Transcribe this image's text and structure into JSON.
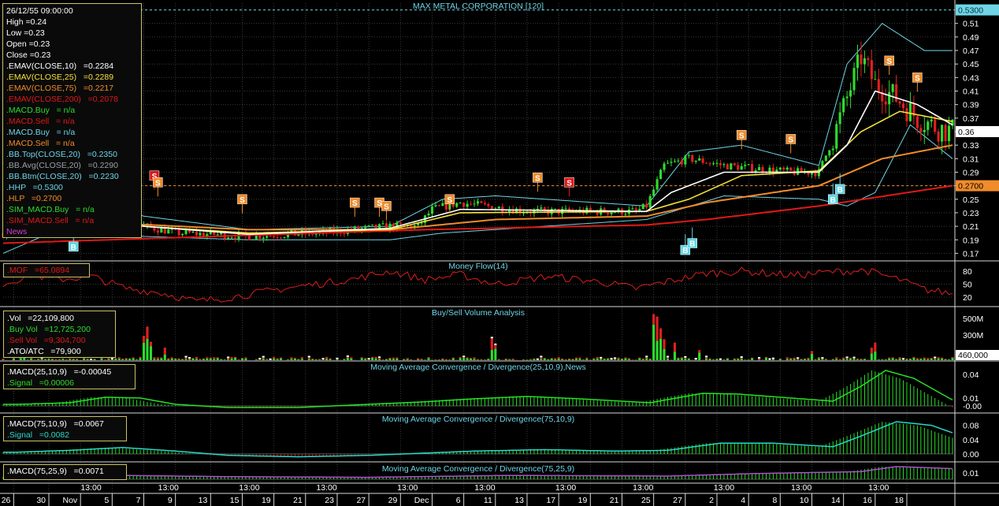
{
  "chart_title": "MAX METAL CORPORATION [120]",
  "info": {
    "date": "26/12/55 09:00:00",
    "high": "High =0.24",
    "low": "Low =0.23",
    "open": "Open =0.23",
    "close": "Close =0.23",
    "emav10": ".EMAV(CLOSE,10)   =0.2284",
    "emav25": ".EMAV(CLOSE,25)   =0.2289",
    "emav75": ".EMAV(CLOSE,75)   =0.2217",
    "emav200": ".EMAV(CLOSE,200)   =0.2078",
    "macd_buy": ".MACD.Buy   = n/a",
    "macd_sell": ".MACD.Sell   = n/a",
    "macd_buy2": ".MACD.Buy   = n/a",
    "macd_sell2": ".MACD.Sell   = n/a",
    "bb_top": ".BB.Top(CLOSE,20)   =0.2350",
    "bb_avg": ".BB.Avg(CLOSE,20)   =0.2290",
    "bb_btm": ".BB.Btm(CLOSE,20)   =0.2230",
    "hhp": ".HHP   =0.5300",
    "hlp": ".HLP   =0.2700",
    "sim_buy": ".SIM_MACD.Buy   = n/a",
    "sim_sell": ".SIM_MACD.Sell   = n/a",
    "news": "News"
  },
  "mof_label": ".MOF   =65.0894",
  "vol_info": {
    "vol": ".Vol   =22,109,800",
    "buy": ".Buy Vol   =12,725,200",
    "sell": ".Sell Vol   =9,304,700",
    "ato": ".ATO/ATC   =79,900"
  },
  "macd1_info": {
    "macd": ".MACD(25,10,9)   =-0.00045",
    "signal": ".Signal   =0.00006"
  },
  "macd2_info": {
    "macd": ".MACD(75,10,9)   =0.0067",
    "signal": ".Signal   =0.0082"
  },
  "macd3_info": {
    "macd": ".MACD(75,25,9)   =0.0071"
  },
  "panel_titles": {
    "mf": "Money Flow(14)",
    "vol": "Buy/Sell Volume Analysis",
    "macd1": "Moving Average Convergence / Divergence(25,10,9),News",
    "macd2": "Moving Average Convergence / Divergence(75,10,9)",
    "macd3": "Moving Average Convergence / Divergence(75,25,9)"
  },
  "colors": {
    "background": "#000000",
    "grid": "#3a3a3a",
    "candle_up": "#2edb2e",
    "candle_down": "#e02020",
    "ema10": "#ffffff",
    "ema25": "#f5e33a",
    "ema75": "#f08c2a",
    "ema200": "#e01818",
    "bollinger": "#6fd5e6",
    "macd_green": "#27e027",
    "macd2_line": "#28d7c8",
    "money_flow": "#d81e1e",
    "hhp_line": "#6fd5e6",
    "hlp_line": "#f08c2a"
  },
  "chart_data": [
    {
      "id": "price",
      "type": "candlestick",
      "title": "MAX METAL CORPORATION [120]",
      "ylim": [
        0.16,
        0.54
      ],
      "y_ticks": [
        0.17,
        0.19,
        0.21,
        0.23,
        0.25,
        0.27,
        0.29,
        0.31,
        0.33,
        0.35,
        0.37,
        0.39,
        0.41,
        0.43,
        0.45,
        0.47,
        0.49,
        0.51
      ],
      "y_tick_labels": [
        "0.17",
        "0.19",
        "0.21",
        "0.23",
        "0.25",
        "0.27",
        "0.29",
        "0.31",
        "0.33",
        "0.35",
        "0.37",
        "0.39",
        "0.41",
        "0.43",
        "0.45",
        "0.47",
        "0.49",
        "0.51"
      ],
      "last_close_label": "0.36",
      "hhp": 0.53,
      "hhp_label": "0.5300",
      "hlp": 0.27,
      "hlp_label": "0.2700",
      "close_keypoints": [
        [
          0,
          0.2
        ],
        [
          5,
          0.205
        ],
        [
          10,
          0.22
        ],
        [
          15,
          0.23
        ],
        [
          20,
          0.24
        ],
        [
          25,
          0.235
        ],
        [
          30,
          0.225
        ],
        [
          35,
          0.215
        ],
        [
          40,
          0.21
        ],
        [
          45,
          0.205
        ],
        [
          50,
          0.2
        ],
        [
          60,
          0.198
        ],
        [
          70,
          0.195
        ],
        [
          80,
          0.198
        ],
        [
          90,
          0.2
        ],
        [
          100,
          0.205
        ],
        [
          110,
          0.21
        ],
        [
          118,
          0.21
        ],
        [
          122,
          0.235
        ],
        [
          130,
          0.245
        ],
        [
          140,
          0.238
        ],
        [
          150,
          0.232
        ],
        [
          160,
          0.232
        ],
        [
          170,
          0.232
        ],
        [
          180,
          0.232
        ],
        [
          183,
          0.24
        ],
        [
          188,
          0.3
        ],
        [
          195,
          0.31
        ],
        [
          205,
          0.3
        ],
        [
          215,
          0.295
        ],
        [
          225,
          0.29
        ],
        [
          232,
          0.29
        ],
        [
          236,
          0.34
        ],
        [
          240,
          0.4
        ],
        [
          244,
          0.46
        ],
        [
          248,
          0.42
        ],
        [
          254,
          0.4
        ],
        [
          260,
          0.37
        ],
        [
          266,
          0.355
        ],
        [
          270,
          0.35
        ]
      ],
      "ema10": [
        [
          0,
          0.205
        ],
        [
          20,
          0.235
        ],
        [
          40,
          0.21
        ],
        [
          70,
          0.198
        ],
        [
          110,
          0.207
        ],
        [
          130,
          0.235
        ],
        [
          183,
          0.232
        ],
        [
          190,
          0.26
        ],
        [
          205,
          0.29
        ],
        [
          232,
          0.29
        ],
        [
          240,
          0.33
        ],
        [
          248,
          0.41
        ],
        [
          260,
          0.39
        ],
        [
          270,
          0.36
        ]
      ],
      "ema25": [
        [
          0,
          0.205
        ],
        [
          20,
          0.225
        ],
        [
          40,
          0.21
        ],
        [
          70,
          0.2
        ],
        [
          110,
          0.205
        ],
        [
          130,
          0.23
        ],
        [
          183,
          0.232
        ],
        [
          195,
          0.25
        ],
        [
          210,
          0.285
        ],
        [
          232,
          0.292
        ],
        [
          244,
          0.35
        ],
        [
          255,
          0.38
        ],
        [
          270,
          0.365
        ]
      ],
      "ema75": [
        [
          0,
          0.2
        ],
        [
          30,
          0.215
        ],
        [
          70,
          0.205
        ],
        [
          110,
          0.205
        ],
        [
          140,
          0.22
        ],
        [
          183,
          0.225
        ],
        [
          200,
          0.245
        ],
        [
          232,
          0.27
        ],
        [
          250,
          0.31
        ],
        [
          270,
          0.33
        ]
      ],
      "ema200": [
        [
          0,
          0.185
        ],
        [
          60,
          0.195
        ],
        [
          120,
          0.205
        ],
        [
          183,
          0.212
        ],
        [
          200,
          0.22
        ],
        [
          232,
          0.24
        ],
        [
          270,
          0.27
        ]
      ],
      "bb_top": [
        [
          0,
          0.2
        ],
        [
          10,
          0.22
        ],
        [
          20,
          0.255
        ],
        [
          40,
          0.225
        ],
        [
          70,
          0.205
        ],
        [
          110,
          0.21
        ],
        [
          125,
          0.25
        ],
        [
          140,
          0.255
        ],
        [
          183,
          0.24
        ],
        [
          195,
          0.32
        ],
        [
          210,
          0.33
        ],
        [
          232,
          0.3
        ],
        [
          240,
          0.45
        ],
        [
          250,
          0.51
        ],
        [
          262,
          0.47
        ],
        [
          270,
          0.47
        ]
      ],
      "bb_btm": [
        [
          0,
          0.17
        ],
        [
          20,
          0.215
        ],
        [
          40,
          0.195
        ],
        [
          70,
          0.19
        ],
        [
          110,
          0.19
        ],
        [
          125,
          0.2
        ],
        [
          183,
          0.22
        ],
        [
          205,
          0.255
        ],
        [
          232,
          0.25
        ],
        [
          240,
          0.24
        ],
        [
          248,
          0.26
        ],
        [
          258,
          0.36
        ],
        [
          270,
          0.31
        ]
      ],
      "buy_signals": [
        [
          20,
          0.18,
          "B"
        ],
        [
          194,
          0.175,
          "B"
        ],
        [
          196,
          0.185,
          "B"
        ],
        [
          236,
          0.25,
          "B"
        ],
        [
          238,
          0.265,
          "B"
        ]
      ],
      "sell_signals": [
        [
          43,
          0.285,
          "S"
        ],
        [
          44,
          0.275,
          "S"
        ],
        [
          68,
          0.25,
          "S"
        ],
        [
          100,
          0.245,
          "S"
        ],
        [
          107,
          0.245,
          "S"
        ],
        [
          109,
          0.24,
          "S"
        ],
        [
          127,
          0.25,
          "S"
        ],
        [
          152,
          0.282,
          "S"
        ],
        [
          161,
          0.275,
          "S"
        ],
        [
          210,
          0.345,
          "S"
        ],
        [
          224,
          0.339,
          "S"
        ],
        [
          252,
          0.455,
          "S"
        ],
        [
          260,
          0.43,
          "S"
        ]
      ]
    },
    {
      "id": "money-flow",
      "type": "line",
      "title": "Money Flow(14)",
      "ylim": [
        0,
        100
      ],
      "y_ticks": [
        20,
        50,
        80
      ],
      "y_tick_labels": [
        "20",
        "50",
        "80"
      ],
      "keypoints": [
        [
          0,
          50
        ],
        [
          8,
          72
        ],
        [
          15,
          60
        ],
        [
          25,
          68
        ],
        [
          35,
          40
        ],
        [
          45,
          30
        ],
        [
          55,
          10
        ],
        [
          65,
          20
        ],
        [
          80,
          40
        ],
        [
          100,
          62
        ],
        [
          110,
          80
        ],
        [
          120,
          60
        ],
        [
          130,
          72
        ],
        [
          140,
          50
        ],
        [
          155,
          68
        ],
        [
          170,
          55
        ],
        [
          180,
          40
        ],
        [
          190,
          58
        ],
        [
          200,
          75
        ],
        [
          210,
          80
        ],
        [
          225,
          70
        ],
        [
          235,
          78
        ],
        [
          245,
          82
        ],
        [
          255,
          60
        ],
        [
          262,
          38
        ],
        [
          270,
          28
        ]
      ]
    },
    {
      "id": "volume",
      "type": "bar",
      "title": "Buy/Sell Volume Analysis",
      "ylim": [
        0,
        620
      ],
      "y_ticks": [
        300,
        500
      ],
      "y_tick_labels": [
        "300M",
        "500M"
      ],
      "last_value_label": "460,000",
      "spikes": [
        [
          40,
          290
        ],
        [
          41,
          400
        ],
        [
          42,
          220
        ],
        [
          46,
          150
        ],
        [
          139,
          260
        ],
        [
          140,
          180
        ],
        [
          185,
          550
        ],
        [
          186,
          520
        ],
        [
          187,
          380
        ],
        [
          188,
          250
        ],
        [
          191,
          210
        ],
        [
          198,
          120
        ],
        [
          230,
          110
        ],
        [
          247,
          150
        ],
        [
          248,
          210
        ]
      ]
    },
    {
      "id": "macd1",
      "type": "histogram",
      "title": "Moving Average Convergence / Divergence(25,10,9),News",
      "ylim": [
        -0.008,
        0.055
      ],
      "y_ticks": [
        0.0,
        0.01,
        0.04
      ],
      "y_tick_labels": [
        "-0.00",
        "0.01",
        "0.04"
      ],
      "keypoints": [
        [
          0,
          0.002
        ],
        [
          15,
          0.004
        ],
        [
          25,
          0.011
        ],
        [
          35,
          0.01
        ],
        [
          45,
          0.002
        ],
        [
          60,
          -0.002
        ],
        [
          80,
          -0.002
        ],
        [
          100,
          0.002
        ],
        [
          115,
          0.005
        ],
        [
          130,
          0.009
        ],
        [
          145,
          0.012
        ],
        [
          160,
          0.009
        ],
        [
          180,
          0.004
        ],
        [
          185,
          0.008
        ],
        [
          195,
          0.016
        ],
        [
          205,
          0.015
        ],
        [
          220,
          0.01
        ],
        [
          232,
          0.006
        ],
        [
          240,
          0.025
        ],
        [
          247,
          0.045
        ],
        [
          255,
          0.035
        ],
        [
          265,
          0.01
        ],
        [
          270,
          -0.002
        ]
      ]
    },
    {
      "id": "macd2",
      "type": "histogram",
      "title": "Moving Average Convergence / Divergence(75,10,9)",
      "ylim": [
        -0.02,
        0.11
      ],
      "y_ticks": [
        0.0,
        0.04,
        0.08
      ],
      "y_tick_labels": [
        "0.00",
        "0.04",
        "0.08"
      ],
      "keypoints": [
        [
          0,
          0.005
        ],
        [
          15,
          0.01
        ],
        [
          30,
          0.018
        ],
        [
          45,
          0.008
        ],
        [
          60,
          -0.004
        ],
        [
          80,
          -0.008
        ],
        [
          100,
          -0.004
        ],
        [
          115,
          0.002
        ],
        [
          130,
          0.008
        ],
        [
          150,
          0.012
        ],
        [
          170,
          0.008
        ],
        [
          185,
          0.01
        ],
        [
          200,
          0.03
        ],
        [
          215,
          0.03
        ],
        [
          232,
          0.02
        ],
        [
          240,
          0.05
        ],
        [
          250,
          0.09
        ],
        [
          260,
          0.08
        ],
        [
          270,
          0.045
        ]
      ]
    },
    {
      "id": "macd3",
      "type": "histogram",
      "title": "Moving Average Convergence / Divergence(75,25,9)",
      "ylim": [
        -0.005,
        0.025
      ],
      "y_ticks": [
        0.01
      ],
      "y_tick_labels": [
        "0.01"
      ],
      "keypoints": [
        [
          0,
          0.004
        ],
        [
          30,
          0.006
        ],
        [
          60,
          0.004
        ],
        [
          100,
          0.003
        ],
        [
          140,
          0.006
        ],
        [
          185,
          0.005
        ],
        [
          210,
          0.009
        ],
        [
          240,
          0.012
        ],
        [
          250,
          0.02
        ],
        [
          270,
          0.016
        ]
      ]
    }
  ],
  "x_axis": {
    "labels": [
      {
        "i": 3,
        "text": "26"
      },
      {
        "i": 13,
        "text": "30"
      },
      {
        "i": 22,
        "text": "Nov"
      },
      {
        "i": 31,
        "text": "5"
      },
      {
        "i": 40,
        "text": "7"
      },
      {
        "i": 49,
        "text": "9"
      },
      {
        "i": 59,
        "text": "13"
      },
      {
        "i": 68,
        "text": "15"
      },
      {
        "i": 77,
        "text": "19"
      },
      {
        "i": 86,
        "text": "21"
      },
      {
        "i": 95,
        "text": "23"
      },
      {
        "i": 104,
        "text": "27"
      },
      {
        "i": 113,
        "text": "29"
      },
      {
        "i": 122,
        "text": "Dec"
      },
      {
        "i": 131,
        "text": "6"
      },
      {
        "i": 140,
        "text": "11"
      },
      {
        "i": 149,
        "text": "13"
      },
      {
        "i": 158,
        "text": "17"
      },
      {
        "i": 167,
        "text": "19"
      },
      {
        "i": 176,
        "text": "21"
      },
      {
        "i": 185,
        "text": "25"
      },
      {
        "i": 194,
        "text": "27"
      },
      {
        "i": 203,
        "text": "2"
      },
      {
        "i": 212,
        "text": "4"
      },
      {
        "i": 221,
        "text": "8"
      },
      {
        "i": 230,
        "text": "10"
      },
      {
        "i": 239,
        "text": "14"
      },
      {
        "i": 248,
        "text": "16"
      },
      {
        "i": 257,
        "text": "18"
      }
    ],
    "time_labels": [
      {
        "i": 25,
        "text": "13:00"
      },
      {
        "i": 47,
        "text": "13:00"
      },
      {
        "i": 70,
        "text": "13:00"
      },
      {
        "i": 92,
        "text": "13:00"
      },
      {
        "i": 115,
        "text": "13:00"
      },
      {
        "i": 137,
        "text": "13:00"
      },
      {
        "i": 160,
        "text": "13:00"
      },
      {
        "i": 182,
        "text": "13:00"
      },
      {
        "i": 205,
        "text": "13:00"
      },
      {
        "i": 227,
        "text": "13:00"
      },
      {
        "i": 249,
        "text": "13:00"
      }
    ]
  }
}
